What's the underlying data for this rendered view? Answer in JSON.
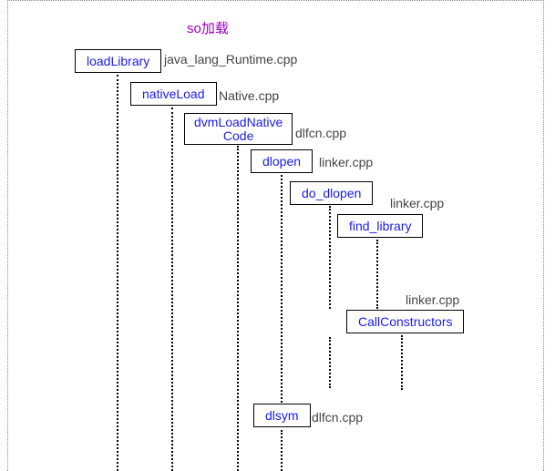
{
  "title": "so加载",
  "nodes": {
    "loadLibrary": {
      "label": "loadLibrary",
      "file": "java_lang_Runtime.cpp"
    },
    "nativeLoad": {
      "label": "nativeLoad",
      "file": "Native.cpp"
    },
    "dvmLoadNativeCode": {
      "label1": "dvmLoadNative",
      "label2": "Code",
      "file": "dlfcn.cpp"
    },
    "dlopen": {
      "label": "dlopen",
      "file": "linker.cpp"
    },
    "do_dlopen": {
      "label": "do_dlopen",
      "file": "linker.cpp"
    },
    "find_library": {
      "label": "find_library",
      "file": ""
    },
    "callConstructors": {
      "label": "CallConstructors",
      "file": "linker.cpp"
    },
    "dlsym": {
      "label": "dlsym",
      "file": "dlfcn.cpp"
    }
  }
}
